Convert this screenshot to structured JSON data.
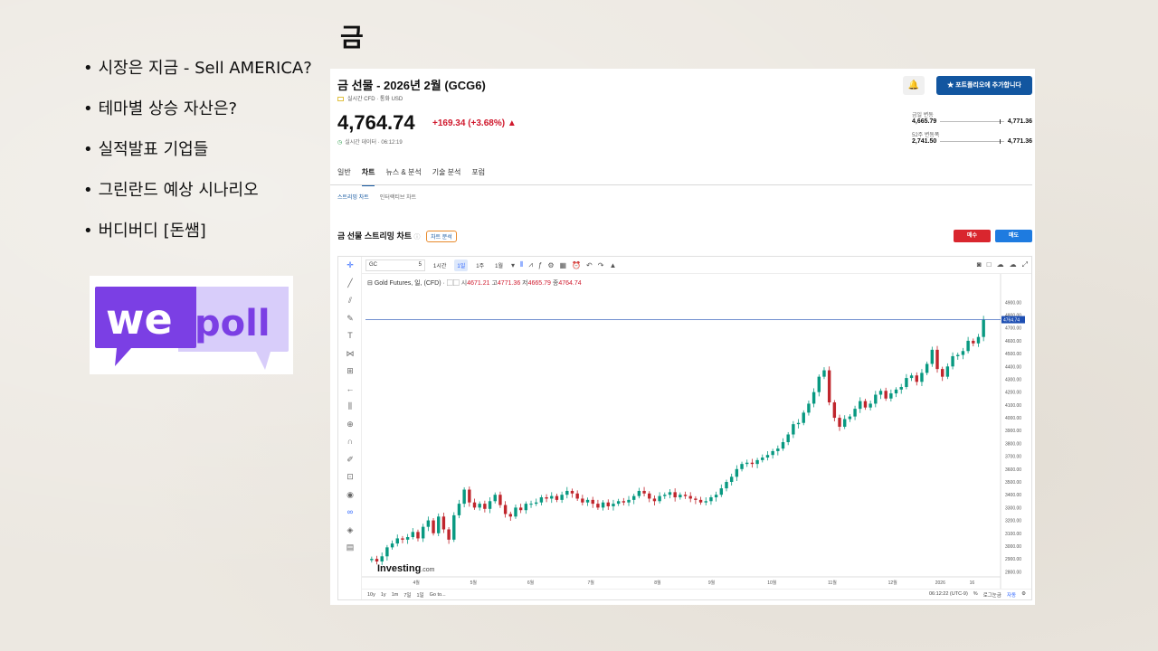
{
  "slide": {
    "title": "금",
    "bullets": [
      "시장은 지금 - Sell AMERICA?",
      "테마별 상승 자산은?",
      "실적발표 기업들",
      "그린란드 예상 시나리오",
      "버디버디 [돈쌤]"
    ],
    "logo_text": [
      "we",
      "poll"
    ],
    "colors": {
      "logo_purple": "#7b3fe4",
      "logo_light": "#d8cdfa",
      "up": "#d0192d",
      "down": "#1e7be0"
    }
  },
  "instrument": {
    "title": "금 선물 - 2026년 2월 (GCG6)",
    "meta": "실시간 CFD  ·  통화  USD",
    "add_portfolio": "★  포트폴리오에 추가합니다",
    "price": "4,764.74",
    "change": "+169.34  (+3.68%)  ▲",
    "realtime": "실시간 데이터 · 06:12:19",
    "day_range_label": "금일 변동",
    "day_low": "4,665.79",
    "day_high": "4,771.36",
    "week52_label": "52주 변동폭",
    "week52_low": "2,741.50",
    "week52_high": "4,771.36"
  },
  "tabs": [
    "일반",
    "차트",
    "뉴스 & 분석",
    "기술 분석",
    "포럼"
  ],
  "subtabs": [
    "스트리밍 차트",
    "인터랙티브 차트"
  ],
  "chart_section": {
    "title": "금 선물 스트리밍 차트",
    "analysis": "차트 분석",
    "buy": "매수",
    "sell": "매도"
  },
  "toolbar": {
    "symbol": "GC",
    "interval_hint": "5",
    "intervals": [
      "1시간",
      "1일",
      "1주",
      "1월"
    ]
  },
  "legend": {
    "name": "Gold Futures, 일, (CFD)",
    "open_label": "시",
    "open": "4671.21",
    "high_label": "고",
    "high": "4771.36",
    "low_label": "저",
    "low": "4665.79",
    "close_label": "종",
    "close": "4764.74"
  },
  "bottom_bar": {
    "ranges": [
      "10y",
      "1y",
      "1m",
      "7일",
      "1일",
      "Go to..."
    ],
    "time": "06:12:22 (UTC-9)",
    "percent": "%",
    "log": "로그눈금",
    "auto": "자동"
  },
  "watermark": {
    "brand": "Investing",
    "suffix": ".com"
  },
  "chart_data": {
    "type": "candlestick",
    "x_labels": [
      "4월",
      "5월",
      "6월",
      "7월",
      "8월",
      "9월",
      "10월",
      "11월",
      "12월",
      "2026",
      "16"
    ],
    "y_ticks": [
      2800,
      2900,
      3000,
      3100,
      3200,
      3300,
      3400,
      3500,
      3600,
      3700,
      3800,
      3900,
      4000,
      4100,
      4200,
      4300,
      4400,
      4500,
      4600,
      4700,
      4800,
      4900
    ],
    "ylim": [
      2760,
      4980
    ],
    "last_price": 4764.74,
    "last_price_label": "4764.74",
    "closes": [
      2900,
      2880,
      2920,
      2990,
      3020,
      3060,
      3050,
      3070,
      3110,
      3060,
      3150,
      3200,
      3100,
      3230,
      3130,
      3050,
      3240,
      3330,
      3440,
      3340,
      3300,
      3330,
      3290,
      3350,
      3400,
      3320,
      3250,
      3230,
      3300,
      3280,
      3330,
      3330,
      3340,
      3380,
      3370,
      3390,
      3360,
      3400,
      3430,
      3410,
      3370,
      3340,
      3360,
      3330,
      3300,
      3340,
      3310,
      3330,
      3350,
      3340,
      3360,
      3390,
      3430,
      3410,
      3370,
      3350,
      3390,
      3400,
      3420,
      3380,
      3400,
      3390,
      3370,
      3360,
      3340,
      3350,
      3380,
      3400,
      3450,
      3500,
      3540,
      3600,
      3640,
      3650,
      3640,
      3670,
      3690,
      3710,
      3740,
      3760,
      3810,
      3870,
      3950,
      3960,
      4040,
      4110,
      4200,
      4320,
      4370,
      4120,
      4000,
      3930,
      3990,
      4010,
      4070,
      4130,
      4080,
      4110,
      4180,
      4210,
      4150,
      4190,
      4220,
      4240,
      4310,
      4330,
      4280,
      4350,
      4420,
      4530,
      4380,
      4320,
      4400,
      4480,
      4490,
      4520,
      4600,
      4580,
      4630,
      4765
    ],
    "series_colors": {
      "up": "#089981",
      "down": "#c0262d"
    }
  }
}
